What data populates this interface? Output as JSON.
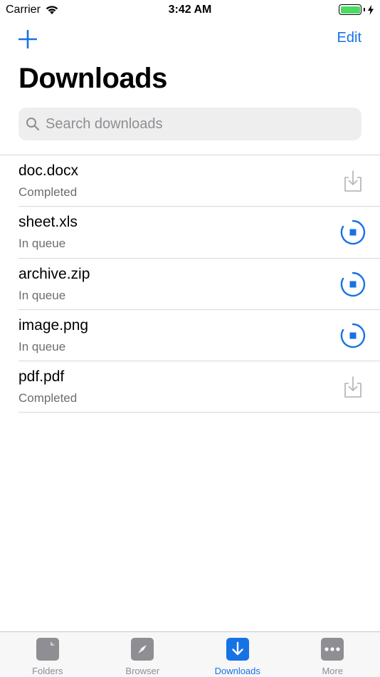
{
  "status_bar": {
    "carrier": "Carrier",
    "time": "3:42 AM",
    "battery_level": 1.0,
    "charging": true
  },
  "nav": {
    "add_icon": "plus-icon",
    "edit_label": "Edit"
  },
  "title": "Downloads",
  "search": {
    "placeholder": "Search downloads",
    "value": ""
  },
  "downloads": [
    {
      "name": "doc.docx",
      "status": "Completed",
      "action_icon": "download-tray-icon"
    },
    {
      "name": "sheet.xls",
      "status": "In queue",
      "action_icon": "stop-progress-icon"
    },
    {
      "name": "archive.zip",
      "status": "In queue",
      "action_icon": "stop-progress-icon"
    },
    {
      "name": "image.png",
      "status": "In queue",
      "action_icon": "stop-progress-icon"
    },
    {
      "name": "pdf.pdf",
      "status": "Completed",
      "action_icon": "download-tray-icon"
    }
  ],
  "tabs": [
    {
      "label": "Folders",
      "icon": "folder-icon",
      "active": false
    },
    {
      "label": "Browser",
      "icon": "compass-icon",
      "active": false
    },
    {
      "label": "Downloads",
      "icon": "download-arrow-icon",
      "active": true
    },
    {
      "label": "More",
      "icon": "ellipsis-icon",
      "active": false
    }
  ],
  "colors": {
    "accent": "#1772e6",
    "inactive": "#8e8e93",
    "battery": "#4cd964"
  }
}
